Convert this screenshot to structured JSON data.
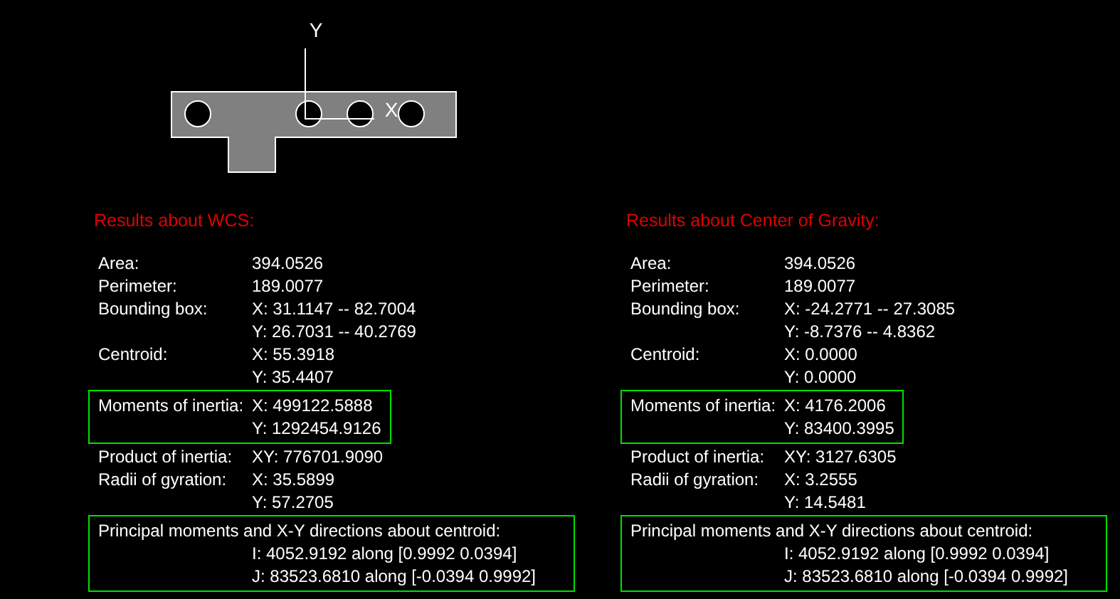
{
  "drawing": {
    "axis_x_label": "X",
    "axis_y_label": "Y"
  },
  "panels": [
    {
      "title": "Results about WCS:",
      "groups": [
        {
          "highlighted": false,
          "lines": [
            {
              "label": "Area:",
              "value": "394.0526"
            },
            {
              "label": "Perimeter:",
              "value": "189.0077"
            },
            {
              "label": "Bounding box:",
              "value": "X: 31.1147  --  82.7004"
            },
            {
              "value": "Y: 26.7031  --  40.2769"
            },
            {
              "label": "Centroid:",
              "value": "X: 55.3918"
            },
            {
              "value": "Y: 35.4407"
            }
          ]
        },
        {
          "highlighted": true,
          "lines": [
            {
              "label": "Moments of inertia:",
              "value": "X: 499122.5888"
            },
            {
              "value": "Y: 1292454.9126"
            }
          ]
        },
        {
          "highlighted": false,
          "lines": [
            {
              "label": "Product of inertia:",
              "value": "XY: 776701.9090"
            },
            {
              "label": "Radii of gyration:",
              "value": "X: 35.5899"
            },
            {
              "value": "Y: 57.2705"
            }
          ]
        },
        {
          "highlighted": true,
          "lines": [
            {
              "label": "Principal moments and X-Y directions about centroid:"
            },
            {
              "value": "I: 4052.9192 along [0.9992 0.0394]"
            },
            {
              "value": "J: 83523.6810 along [-0.0394 0.9992]"
            }
          ]
        }
      ]
    },
    {
      "title": "Results about Center of Gravity:",
      "groups": [
        {
          "highlighted": false,
          "lines": [
            {
              "label": "Area:",
              "value": "394.0526"
            },
            {
              "label": "Perimeter:",
              "value": "189.0077"
            },
            {
              "label": "Bounding box:",
              "value": "X: -24.2771  --  27.3085"
            },
            {
              "value": "Y: -8.7376  --  4.8362"
            },
            {
              "label": "Centroid:",
              "value": "X: 0.0000"
            },
            {
              "value": "Y: 0.0000"
            }
          ]
        },
        {
          "highlighted": true,
          "lines": [
            {
              "label": "Moments of inertia:",
              "value": "X: 4176.2006"
            },
            {
              "value": "Y: 83400.3995"
            }
          ]
        },
        {
          "highlighted": false,
          "lines": [
            {
              "label": "Product of inertia:",
              "value": "XY: 3127.6305"
            },
            {
              "label": "Radii of gyration:",
              "value": "X: 3.2555"
            },
            {
              "value": "Y: 14.5481"
            }
          ]
        },
        {
          "highlighted": true,
          "lines": [
            {
              "label": "Principal moments and X-Y directions about centroid:"
            },
            {
              "value": "I: 4052.9192 along [0.9992 0.0394]"
            },
            {
              "value": "J: 83523.6810 along [-0.0394 0.9992]"
            }
          ]
        }
      ]
    }
  ]
}
